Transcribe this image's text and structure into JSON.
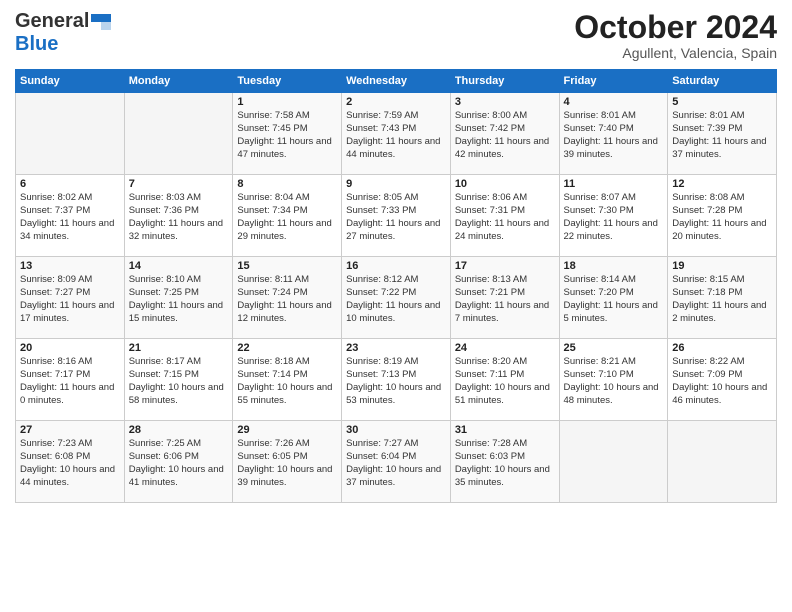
{
  "header": {
    "logo_general": "General",
    "logo_blue": "Blue",
    "month": "October 2024",
    "location": "Agullent, Valencia, Spain"
  },
  "weekdays": [
    "Sunday",
    "Monday",
    "Tuesday",
    "Wednesday",
    "Thursday",
    "Friday",
    "Saturday"
  ],
  "weeks": [
    [
      {
        "day": "",
        "info": ""
      },
      {
        "day": "",
        "info": ""
      },
      {
        "day": "1",
        "info": "Sunrise: 7:58 AM\nSunset: 7:45 PM\nDaylight: 11 hours and 47 minutes."
      },
      {
        "day": "2",
        "info": "Sunrise: 7:59 AM\nSunset: 7:43 PM\nDaylight: 11 hours and 44 minutes."
      },
      {
        "day": "3",
        "info": "Sunrise: 8:00 AM\nSunset: 7:42 PM\nDaylight: 11 hours and 42 minutes."
      },
      {
        "day": "4",
        "info": "Sunrise: 8:01 AM\nSunset: 7:40 PM\nDaylight: 11 hours and 39 minutes."
      },
      {
        "day": "5",
        "info": "Sunrise: 8:01 AM\nSunset: 7:39 PM\nDaylight: 11 hours and 37 minutes."
      }
    ],
    [
      {
        "day": "6",
        "info": "Sunrise: 8:02 AM\nSunset: 7:37 PM\nDaylight: 11 hours and 34 minutes."
      },
      {
        "day": "7",
        "info": "Sunrise: 8:03 AM\nSunset: 7:36 PM\nDaylight: 11 hours and 32 minutes."
      },
      {
        "day": "8",
        "info": "Sunrise: 8:04 AM\nSunset: 7:34 PM\nDaylight: 11 hours and 29 minutes."
      },
      {
        "day": "9",
        "info": "Sunrise: 8:05 AM\nSunset: 7:33 PM\nDaylight: 11 hours and 27 minutes."
      },
      {
        "day": "10",
        "info": "Sunrise: 8:06 AM\nSunset: 7:31 PM\nDaylight: 11 hours and 24 minutes."
      },
      {
        "day": "11",
        "info": "Sunrise: 8:07 AM\nSunset: 7:30 PM\nDaylight: 11 hours and 22 minutes."
      },
      {
        "day": "12",
        "info": "Sunrise: 8:08 AM\nSunset: 7:28 PM\nDaylight: 11 hours and 20 minutes."
      }
    ],
    [
      {
        "day": "13",
        "info": "Sunrise: 8:09 AM\nSunset: 7:27 PM\nDaylight: 11 hours and 17 minutes."
      },
      {
        "day": "14",
        "info": "Sunrise: 8:10 AM\nSunset: 7:25 PM\nDaylight: 11 hours and 15 minutes."
      },
      {
        "day": "15",
        "info": "Sunrise: 8:11 AM\nSunset: 7:24 PM\nDaylight: 11 hours and 12 minutes."
      },
      {
        "day": "16",
        "info": "Sunrise: 8:12 AM\nSunset: 7:22 PM\nDaylight: 11 hours and 10 minutes."
      },
      {
        "day": "17",
        "info": "Sunrise: 8:13 AM\nSunset: 7:21 PM\nDaylight: 11 hours and 7 minutes."
      },
      {
        "day": "18",
        "info": "Sunrise: 8:14 AM\nSunset: 7:20 PM\nDaylight: 11 hours and 5 minutes."
      },
      {
        "day": "19",
        "info": "Sunrise: 8:15 AM\nSunset: 7:18 PM\nDaylight: 11 hours and 2 minutes."
      }
    ],
    [
      {
        "day": "20",
        "info": "Sunrise: 8:16 AM\nSunset: 7:17 PM\nDaylight: 11 hours and 0 minutes."
      },
      {
        "day": "21",
        "info": "Sunrise: 8:17 AM\nSunset: 7:15 PM\nDaylight: 10 hours and 58 minutes."
      },
      {
        "day": "22",
        "info": "Sunrise: 8:18 AM\nSunset: 7:14 PM\nDaylight: 10 hours and 55 minutes."
      },
      {
        "day": "23",
        "info": "Sunrise: 8:19 AM\nSunset: 7:13 PM\nDaylight: 10 hours and 53 minutes."
      },
      {
        "day": "24",
        "info": "Sunrise: 8:20 AM\nSunset: 7:11 PM\nDaylight: 10 hours and 51 minutes."
      },
      {
        "day": "25",
        "info": "Sunrise: 8:21 AM\nSunset: 7:10 PM\nDaylight: 10 hours and 48 minutes."
      },
      {
        "day": "26",
        "info": "Sunrise: 8:22 AM\nSunset: 7:09 PM\nDaylight: 10 hours and 46 minutes."
      }
    ],
    [
      {
        "day": "27",
        "info": "Sunrise: 7:23 AM\nSunset: 6:08 PM\nDaylight: 10 hours and 44 minutes."
      },
      {
        "day": "28",
        "info": "Sunrise: 7:25 AM\nSunset: 6:06 PM\nDaylight: 10 hours and 41 minutes."
      },
      {
        "day": "29",
        "info": "Sunrise: 7:26 AM\nSunset: 6:05 PM\nDaylight: 10 hours and 39 minutes."
      },
      {
        "day": "30",
        "info": "Sunrise: 7:27 AM\nSunset: 6:04 PM\nDaylight: 10 hours and 37 minutes."
      },
      {
        "day": "31",
        "info": "Sunrise: 7:28 AM\nSunset: 6:03 PM\nDaylight: 10 hours and 35 minutes."
      },
      {
        "day": "",
        "info": ""
      },
      {
        "day": "",
        "info": ""
      }
    ]
  ]
}
